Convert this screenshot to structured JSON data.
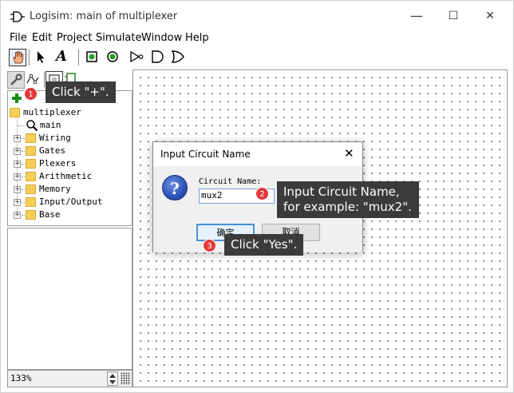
{
  "window": {
    "title": "Logisim: main of multiplexer",
    "minimize": "—",
    "maximize": "☐",
    "close": "✕"
  },
  "menu": [
    "File",
    "Edit",
    "Project",
    "Simulate",
    "Window",
    "Help"
  ],
  "toolbar": {
    "tools": [
      "hand-poke-icon",
      "arrow-select-icon",
      "text-tool-icon",
      "input-pin-icon",
      "output-pin-icon",
      "not-gate-icon",
      "and-gate-icon",
      "or-gate-icon"
    ],
    "text_tool_glyph": "A"
  },
  "project_tree": {
    "root": "multiplexer",
    "circuit": "main",
    "libraries": [
      "Wiring",
      "Gates",
      "Plexers",
      "Arithmetic",
      "Memory",
      "Input/Output",
      "Base"
    ]
  },
  "zoom": {
    "value": "133%"
  },
  "dialog": {
    "title": "Input Circuit Name",
    "close_glyph": "✕",
    "question_glyph": "?",
    "label": "Circuit Name:",
    "input_value": "mux2",
    "ok_label": "确定",
    "cancel_label": "取消"
  },
  "annotations": {
    "step1": {
      "badge": "1",
      "text": "Click \"+\"."
    },
    "step2": {
      "badge": "2",
      "text_line1": "Input Circuit Name,",
      "text_line2": "for example: \"mux2\"."
    },
    "step3": {
      "badge": "3",
      "text": "Click \"Yes\"."
    }
  },
  "colors": {
    "add_button": "#1a8a1a",
    "badge": "#e43a3a",
    "callout_bg": "#3b3b3b",
    "folder": "#f6cf5a"
  }
}
